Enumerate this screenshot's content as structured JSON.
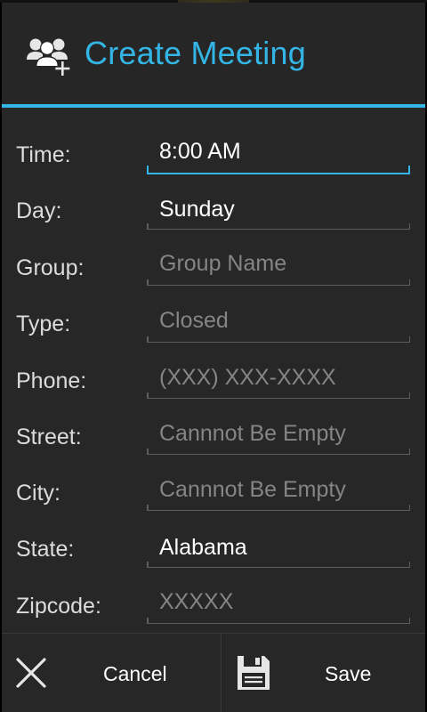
{
  "dialog": {
    "title": "Create Meeting",
    "title_icon": "add-group-icon",
    "accent_color": "#33b5e5"
  },
  "form": {
    "time": {
      "label": "Time:",
      "value": "8:00 AM",
      "placeholder": ""
    },
    "day": {
      "label": "Day:",
      "value": "Sunday",
      "placeholder": ""
    },
    "group": {
      "label": "Group:",
      "value": "",
      "placeholder": "Group Name"
    },
    "type": {
      "label": "Type:",
      "value": "",
      "placeholder": "Closed"
    },
    "phone": {
      "label": "Phone:",
      "value": "",
      "placeholder": "(XXX) XXX-XXXX"
    },
    "street": {
      "label": "Street:",
      "value": "",
      "placeholder": "Cannnot Be Empty"
    },
    "city": {
      "label": "City:",
      "value": "",
      "placeholder": "Cannnot Be Empty"
    },
    "state": {
      "label": "State:",
      "value": "Alabama",
      "placeholder": ""
    },
    "zipcode": {
      "label": "Zipcode:",
      "value": "",
      "placeholder": "XXXXX"
    }
  },
  "buttons": {
    "cancel": {
      "label": "Cancel",
      "icon": "close-icon"
    },
    "save": {
      "label": "Save",
      "icon": "save-icon"
    }
  }
}
